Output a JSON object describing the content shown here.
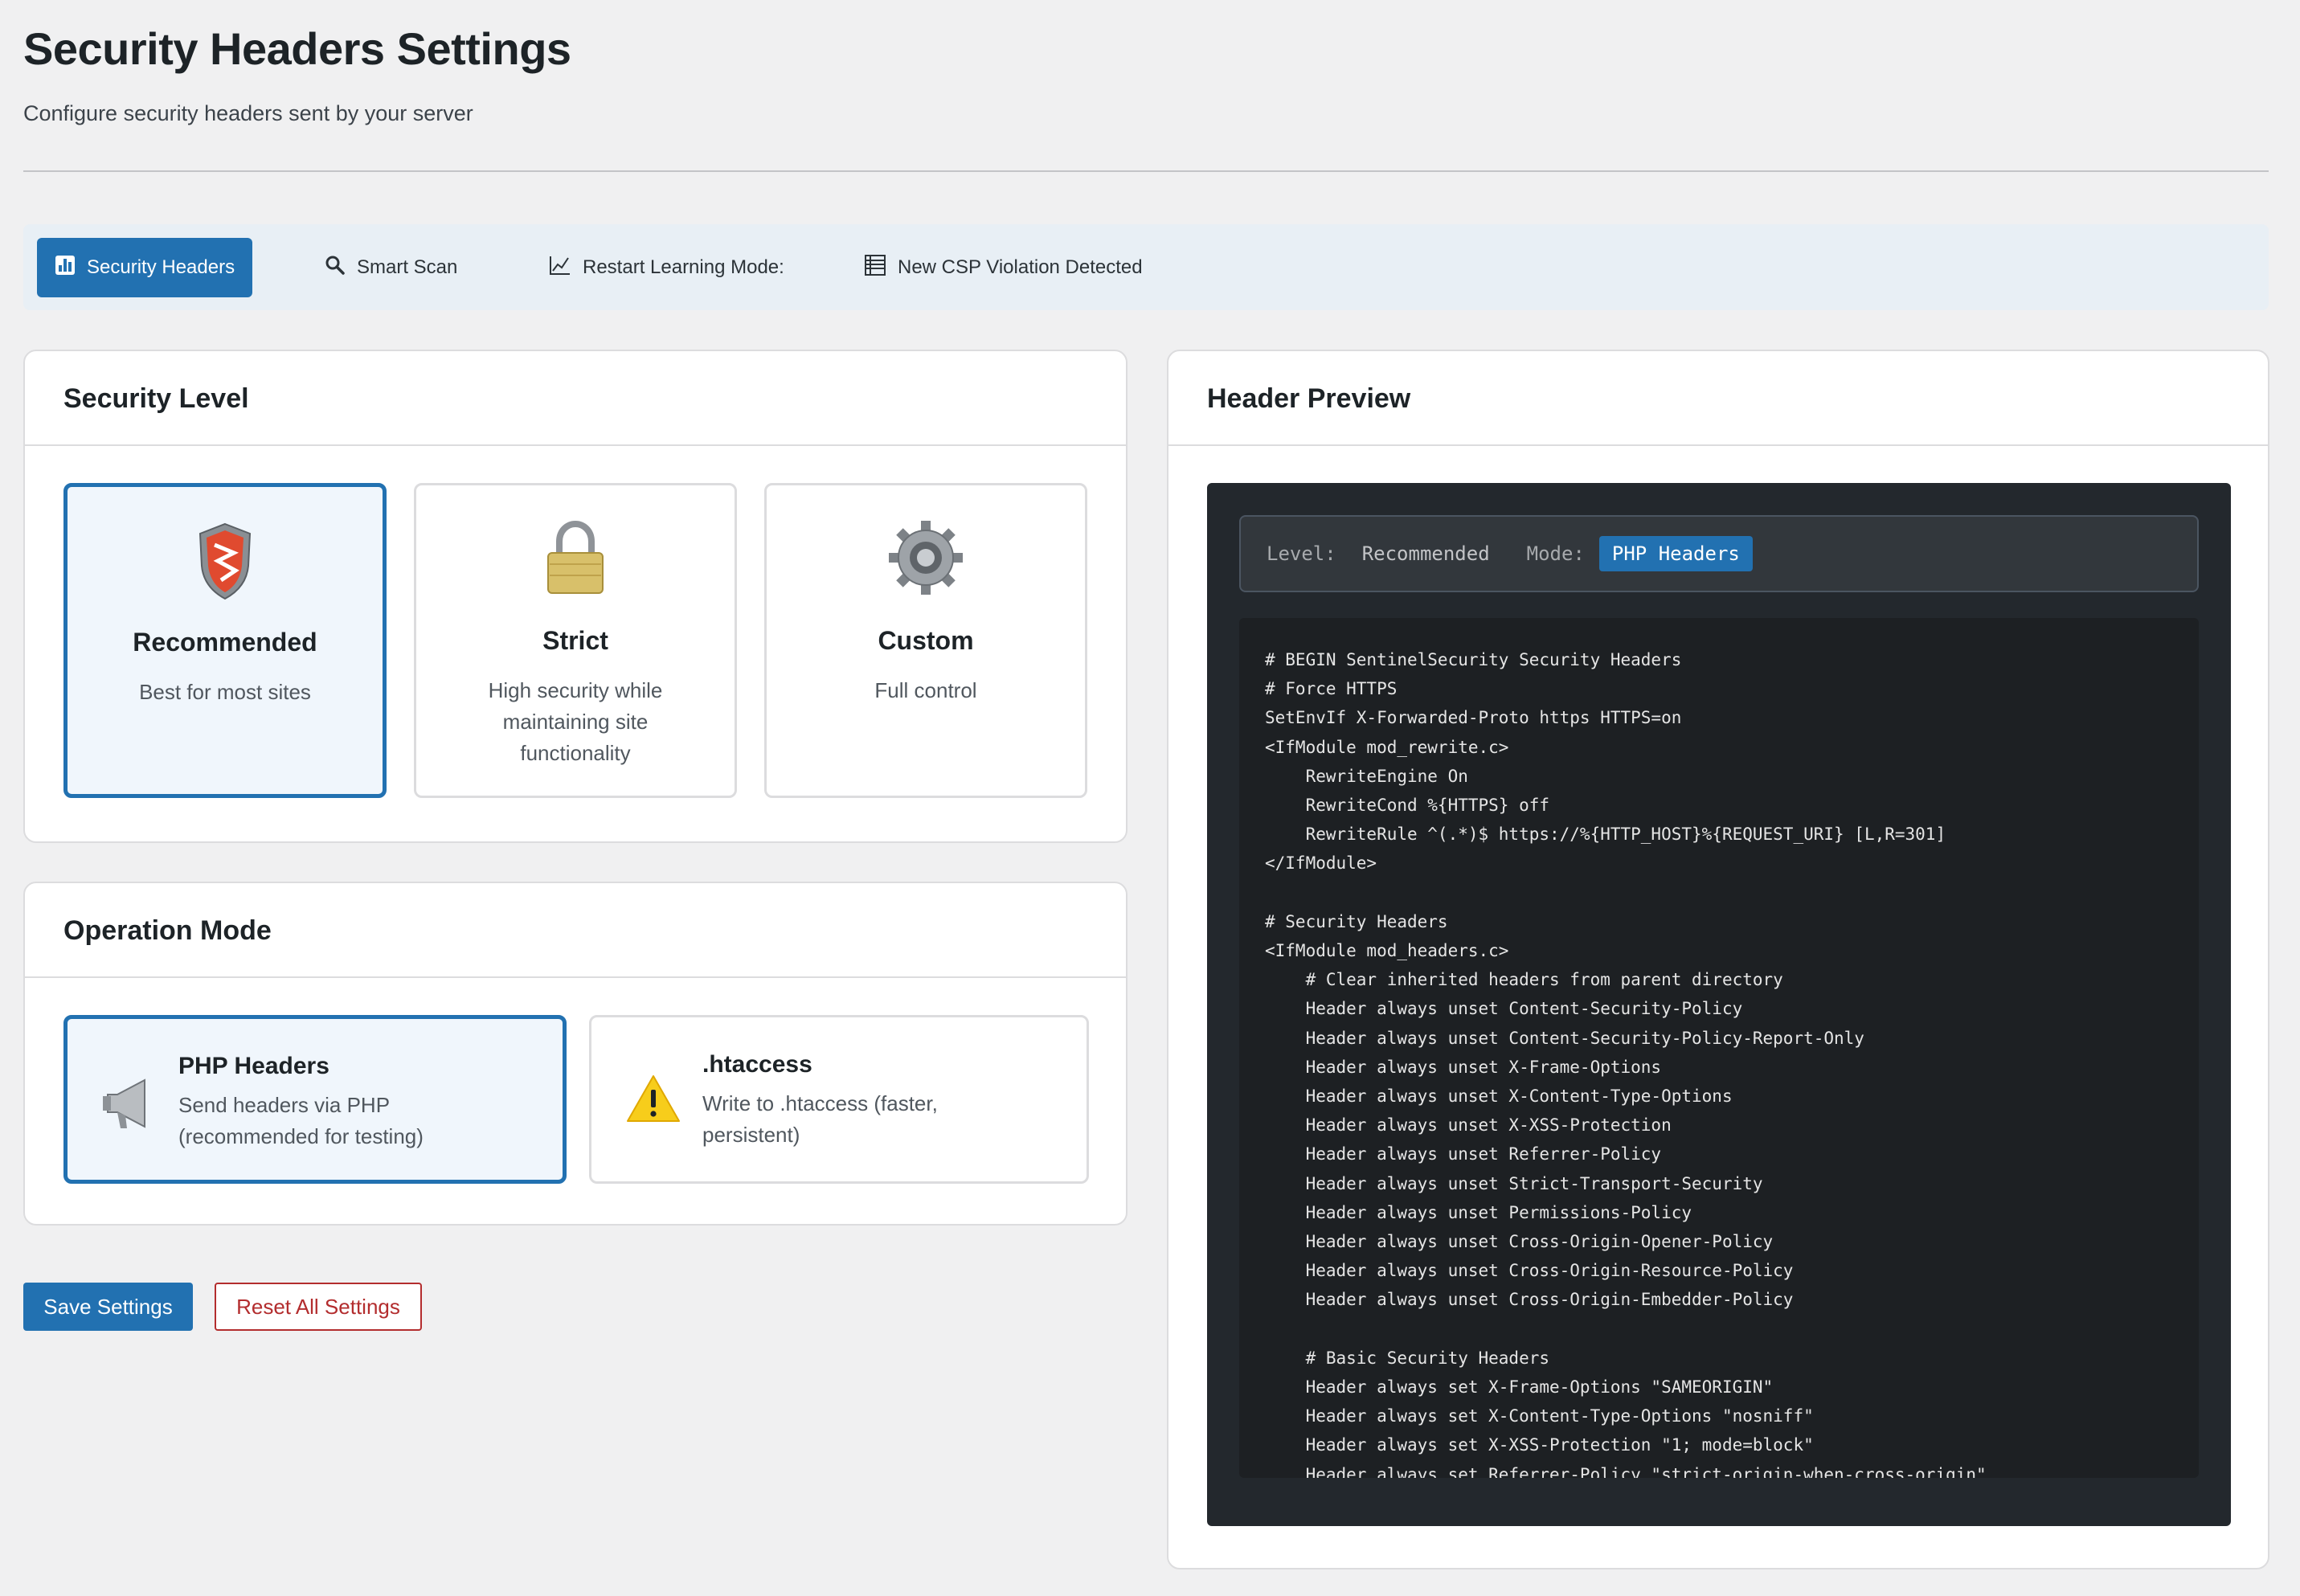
{
  "page": {
    "title": "Security Headers Settings",
    "subtitle": "Configure security headers sent by your server"
  },
  "tabs": [
    {
      "label": "Security Headers",
      "icon": "dashboard-icon",
      "active": true
    },
    {
      "label": "Smart Scan",
      "icon": "search-icon",
      "active": false
    },
    {
      "label": "Restart Learning Mode:",
      "icon": "chart-line-icon",
      "active": false
    },
    {
      "label": "New CSP Violation Detected",
      "icon": "table-list-icon",
      "active": false
    }
  ],
  "security_level": {
    "title": "Security Level",
    "options": [
      {
        "name": "Recommended",
        "desc": "Best for most sites",
        "icon": "shield-icon",
        "selected": true
      },
      {
        "name": "Strict",
        "desc": "High security while maintaining site functionality",
        "icon": "padlock-icon",
        "selected": false
      },
      {
        "name": "Custom",
        "desc": "Full control",
        "icon": "gear-icon",
        "selected": false
      }
    ]
  },
  "operation_mode": {
    "title": "Operation Mode",
    "options": [
      {
        "name": "PHP Headers",
        "desc": "Send headers via PHP (recommended for testing)",
        "icon": "megaphone-icon",
        "selected": true
      },
      {
        "name": ".htaccess",
        "desc": "Write to .htaccess (faster, persistent)",
        "icon": "warning-icon",
        "selected": false
      }
    ]
  },
  "buttons": {
    "save": "Save Settings",
    "reset": "Reset All Settings"
  },
  "preview": {
    "title": "Header Preview",
    "level_label": "Level:",
    "level_value": "Recommended",
    "mode_label": "Mode:",
    "mode_value": "PHP Headers",
    "code": "# BEGIN SentinelSecurity Security Headers\n# Force HTTPS\nSetEnvIf X-Forwarded-Proto https HTTPS=on\n<IfModule mod_rewrite.c>\n    RewriteEngine On\n    RewriteCond %{HTTPS} off\n    RewriteRule ^(.*)$ https://%{HTTP_HOST}%{REQUEST_URI} [L,R=301]\n</IfModule>\n\n# Security Headers\n<IfModule mod_headers.c>\n    # Clear inherited headers from parent directory\n    Header always unset Content-Security-Policy\n    Header always unset Content-Security-Policy-Report-Only\n    Header always unset X-Frame-Options\n    Header always unset X-Content-Type-Options\n    Header always unset X-XSS-Protection\n    Header always unset Referrer-Policy\n    Header always unset Strict-Transport-Security\n    Header always unset Permissions-Policy\n    Header always unset Cross-Origin-Opener-Policy\n    Header always unset Cross-Origin-Resource-Policy\n    Header always unset Cross-Origin-Embedder-Policy\n\n    # Basic Security Headers\n    Header always set X-Frame-Options \"SAMEORIGIN\"\n    Header always set X-Content-Type-Options \"nosniff\"\n    Header always set X-XSS-Protection \"1; mode=block\"\n    Header always set Referrer-Policy \"strict-origin-when-cross-origin\""
  },
  "colors": {
    "accent": "#2271b1",
    "danger": "#b32d2e",
    "code_bg": "#23282d"
  }
}
